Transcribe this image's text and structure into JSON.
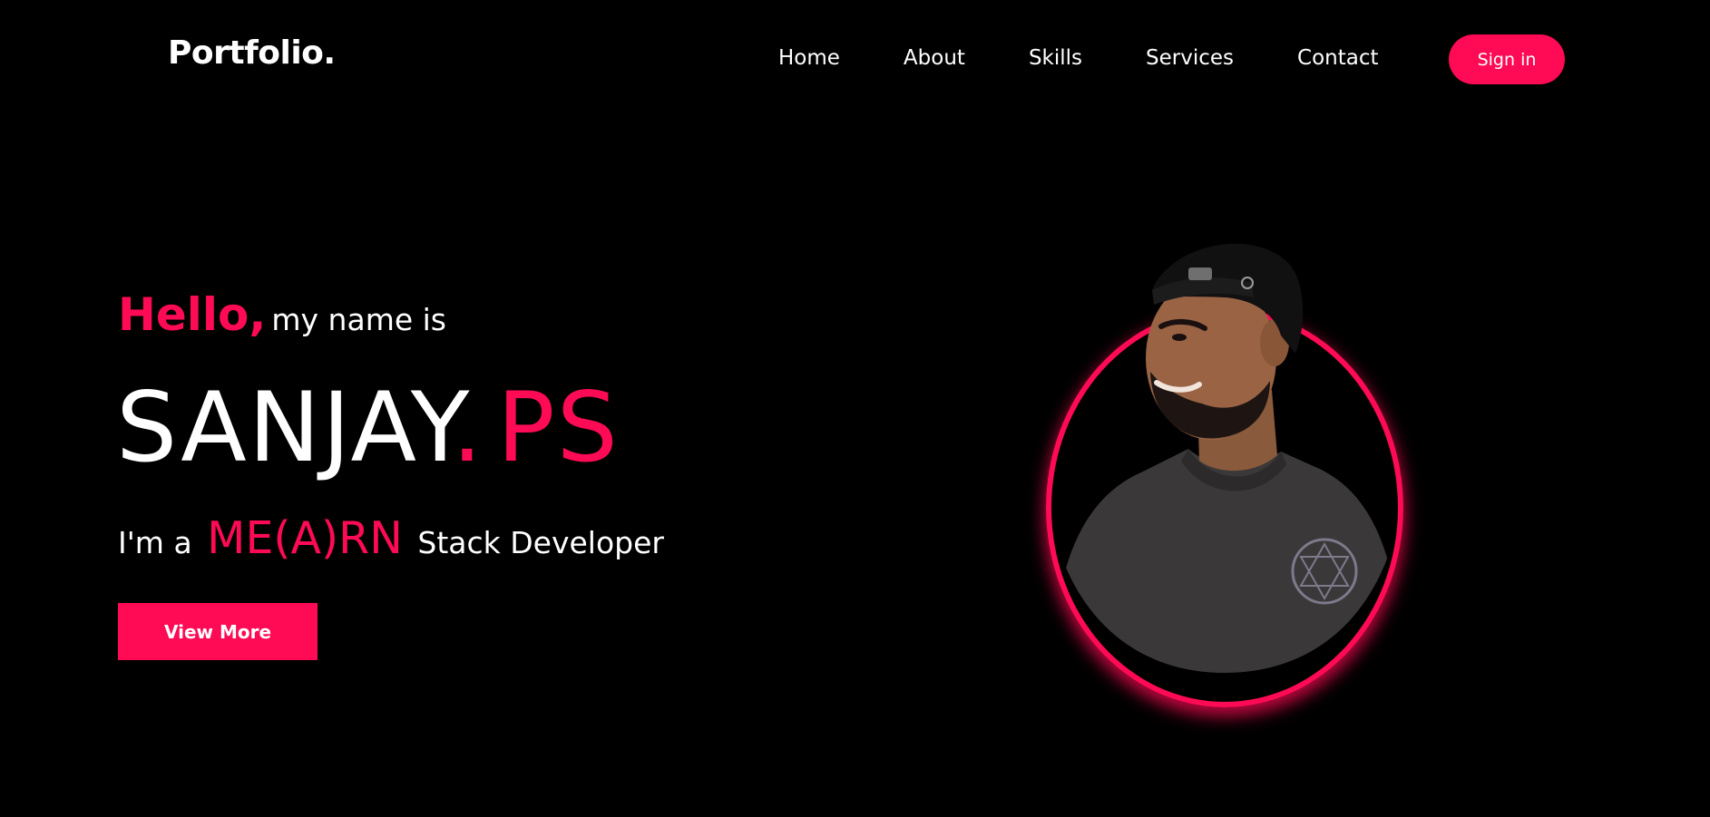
{
  "header": {
    "logo": "Portfolio.",
    "nav": [
      "Home",
      "About",
      "Skills",
      "Services",
      "Contact"
    ],
    "signin_label": "Sign in"
  },
  "hero": {
    "hello": "Hello,",
    "hello_rest": "my name is",
    "first_name": "SANJAY",
    "dot": ".",
    "last_name": "PS",
    "role_prefix": "I'm a",
    "role_highlight": "ME(A)RN",
    "role_suffix": "Stack Developer",
    "cta_label": "View More"
  },
  "colors": {
    "accent": "#ff0a54",
    "background": "#000000",
    "text": "#ffffff"
  },
  "icons": {
    "portrait": "person-photo"
  }
}
